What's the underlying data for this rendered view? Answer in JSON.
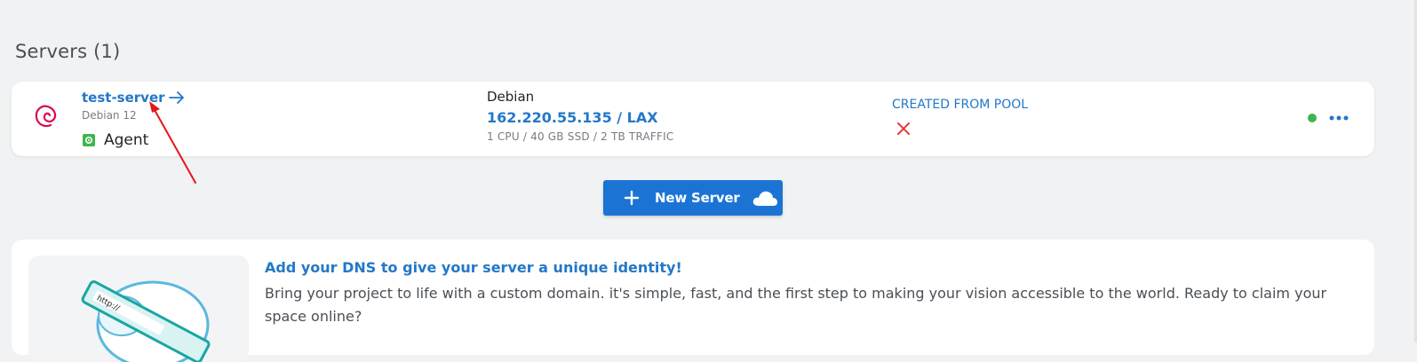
{
  "section": {
    "title": "Servers (1)"
  },
  "server": {
    "name": "test-server",
    "os_version": "Debian 12",
    "agent_label": "Agent",
    "os_name": "Debian",
    "ip_location": "162.220.55.135 / LAX",
    "specs": "1 CPU / 40 GB SSD / 2 TB TRAFFIC",
    "pool_label": "CREATED FROM POOL",
    "pool_value": "no",
    "status": "online"
  },
  "new_server_button": {
    "label": "New Server"
  },
  "dns_promo": {
    "title": "Add your DNS to give your server a unique identity!",
    "body": "Bring your project to life with a custom domain. it's simple, fast, and the first step to making your vision accessible to the world. Ready to claim your space online?",
    "illustration_text": "http://"
  },
  "colors": {
    "accent": "#2378c8",
    "button": "#1b74d4",
    "status_online": "#3fb54c",
    "error": "#e53935",
    "debian": "#d70a53"
  },
  "icons": {
    "os": "debian-logo-icon",
    "name_link": "arrow-right-icon",
    "agent": "agent-gear-icon",
    "pool": "close-icon",
    "more": "more-horizontal-icon",
    "plus": "plus-icon",
    "cloud": "cloud-icon"
  }
}
